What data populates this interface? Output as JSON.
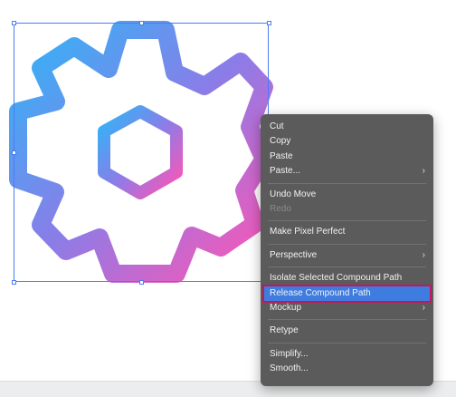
{
  "artwork": {
    "gradient_colors": [
      "#2eb6f7",
      "#8a7de8",
      "#ff55b5"
    ]
  },
  "context_menu": {
    "items": [
      {
        "label": "Cut",
        "enabled": true
      },
      {
        "label": "Copy",
        "enabled": true
      },
      {
        "label": "Paste",
        "enabled": true
      },
      {
        "label": "Paste...",
        "enabled": true,
        "submenu": true
      },
      {
        "label": "Undo Move",
        "enabled": true
      },
      {
        "label": "Redo",
        "enabled": false
      },
      {
        "label": "Make Pixel Perfect",
        "enabled": true
      },
      {
        "label": "Perspective",
        "enabled": true,
        "submenu": true
      },
      {
        "label": "Isolate Selected Compound Path",
        "enabled": true
      },
      {
        "label": "Release Compound Path",
        "enabled": true,
        "highlighted": true
      },
      {
        "label": "Mockup",
        "enabled": true,
        "submenu": true
      },
      {
        "label": "Retype",
        "enabled": true
      },
      {
        "label": "Simplify...",
        "enabled": true
      },
      {
        "label": "Smooth...",
        "enabled": true
      }
    ],
    "submenu_arrow": "›",
    "highlight_color": "#3f7ce0",
    "highlight_border_color": "#c0185f"
  }
}
